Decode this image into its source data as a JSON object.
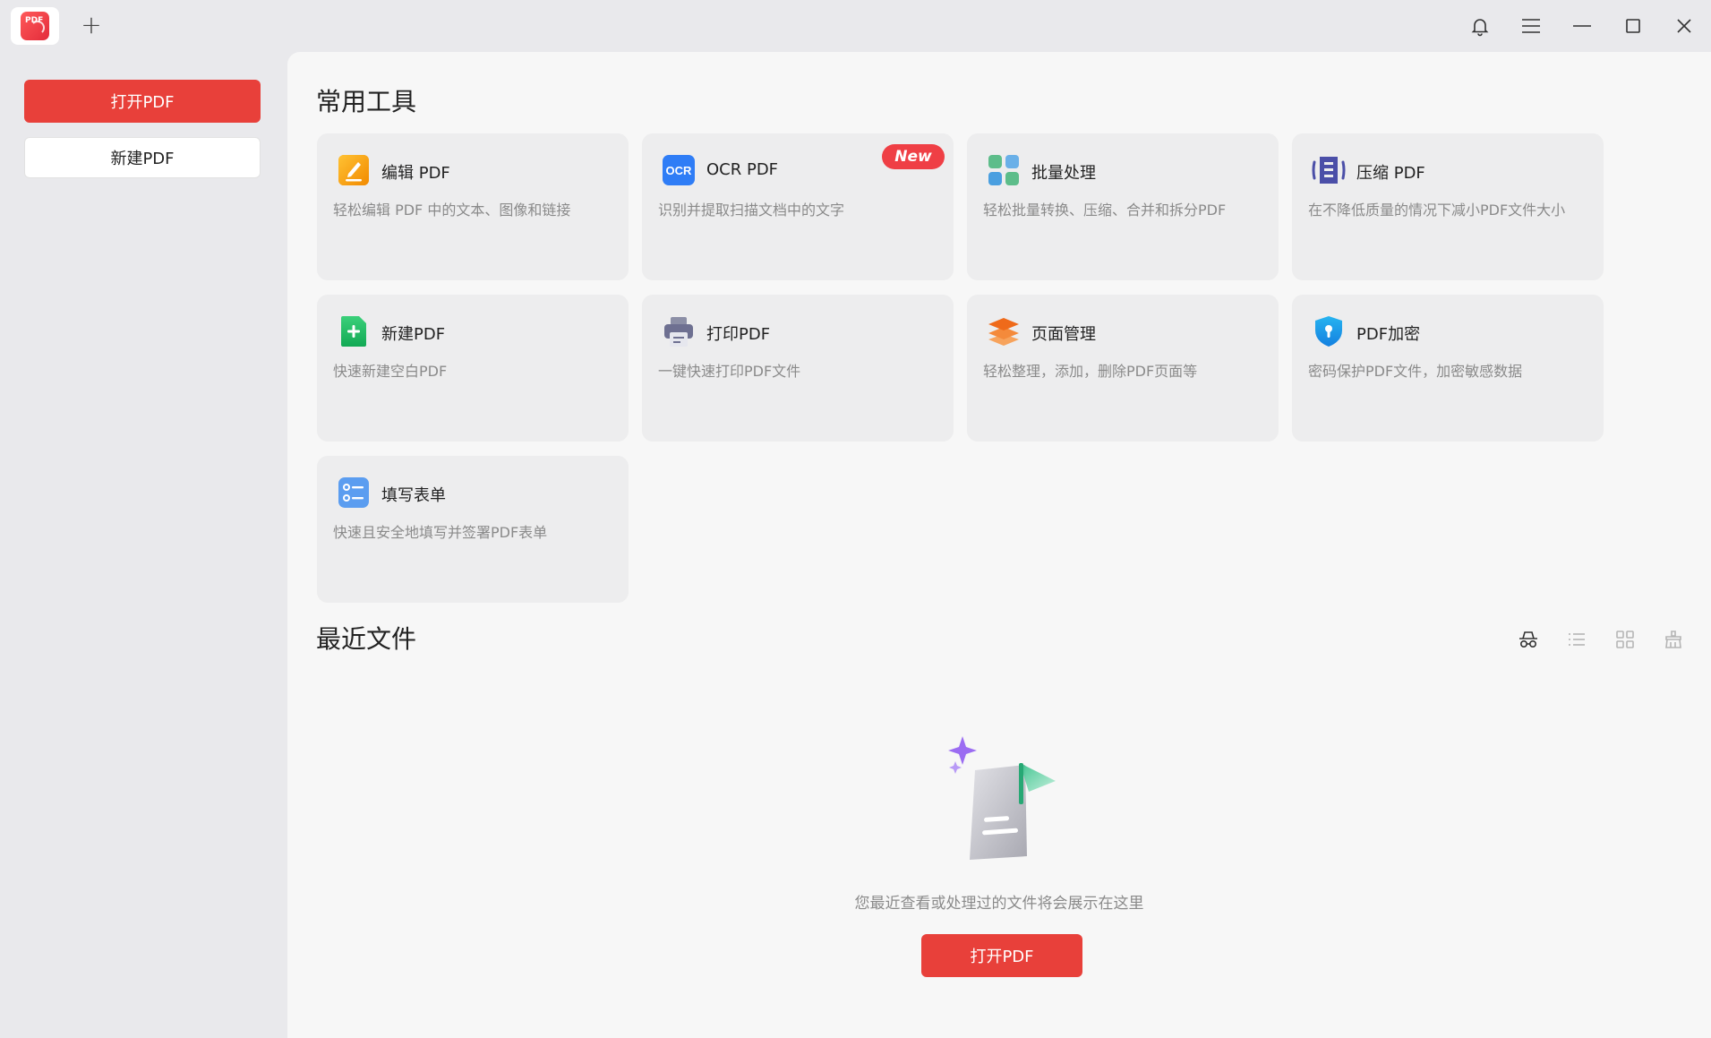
{
  "titlebar": {
    "logo_text": "PDF",
    "new_tab": "+",
    "icons": [
      "bell-icon",
      "menu-icon",
      "minimize-icon",
      "maximize-icon",
      "close-icon"
    ]
  },
  "sidebar": {
    "open_pdf": "打开PDF",
    "new_pdf": "新建PDF"
  },
  "main": {
    "tools_title": "常用工具",
    "tools": [
      {
        "name": "编辑 PDF",
        "desc": "轻松编辑 PDF 中的文本、图像和链接",
        "icon": "edit-pdf-icon"
      },
      {
        "name": "OCR PDF",
        "desc": "识别并提取扫描文档中的文字",
        "icon": "ocr-icon",
        "badge": "New"
      },
      {
        "name": "批量处理",
        "desc": "轻松批量转换、压缩、合并和拆分PDF",
        "icon": "batch-icon"
      },
      {
        "name": "压缩 PDF",
        "desc": "在不降低质量的情况下减小PDF文件大小",
        "icon": "compress-icon"
      },
      {
        "name": "新建PDF",
        "desc": "快速新建空白PDF",
        "icon": "new-pdf-icon"
      },
      {
        "name": "打印PDF",
        "desc": "一键快速打印PDF文件",
        "icon": "print-icon"
      },
      {
        "name": "页面管理",
        "desc": "轻松整理，添加，删除PDF页面等",
        "icon": "page-manage-icon"
      },
      {
        "name": "PDF加密",
        "desc": "密码保护PDF文件，加密敏感数据",
        "icon": "encrypt-icon"
      },
      {
        "name": "填写表单",
        "desc": "快速且安全地填写并签署PDF表单",
        "icon": "form-icon"
      }
    ],
    "recent_title": "最近文件",
    "empty_text": "您最近查看或处理过的文件将会展示在这里",
    "open_pdf": "打开PDF"
  },
  "colors": {
    "accent": "#e8403a",
    "badge": "#ef3f45"
  }
}
